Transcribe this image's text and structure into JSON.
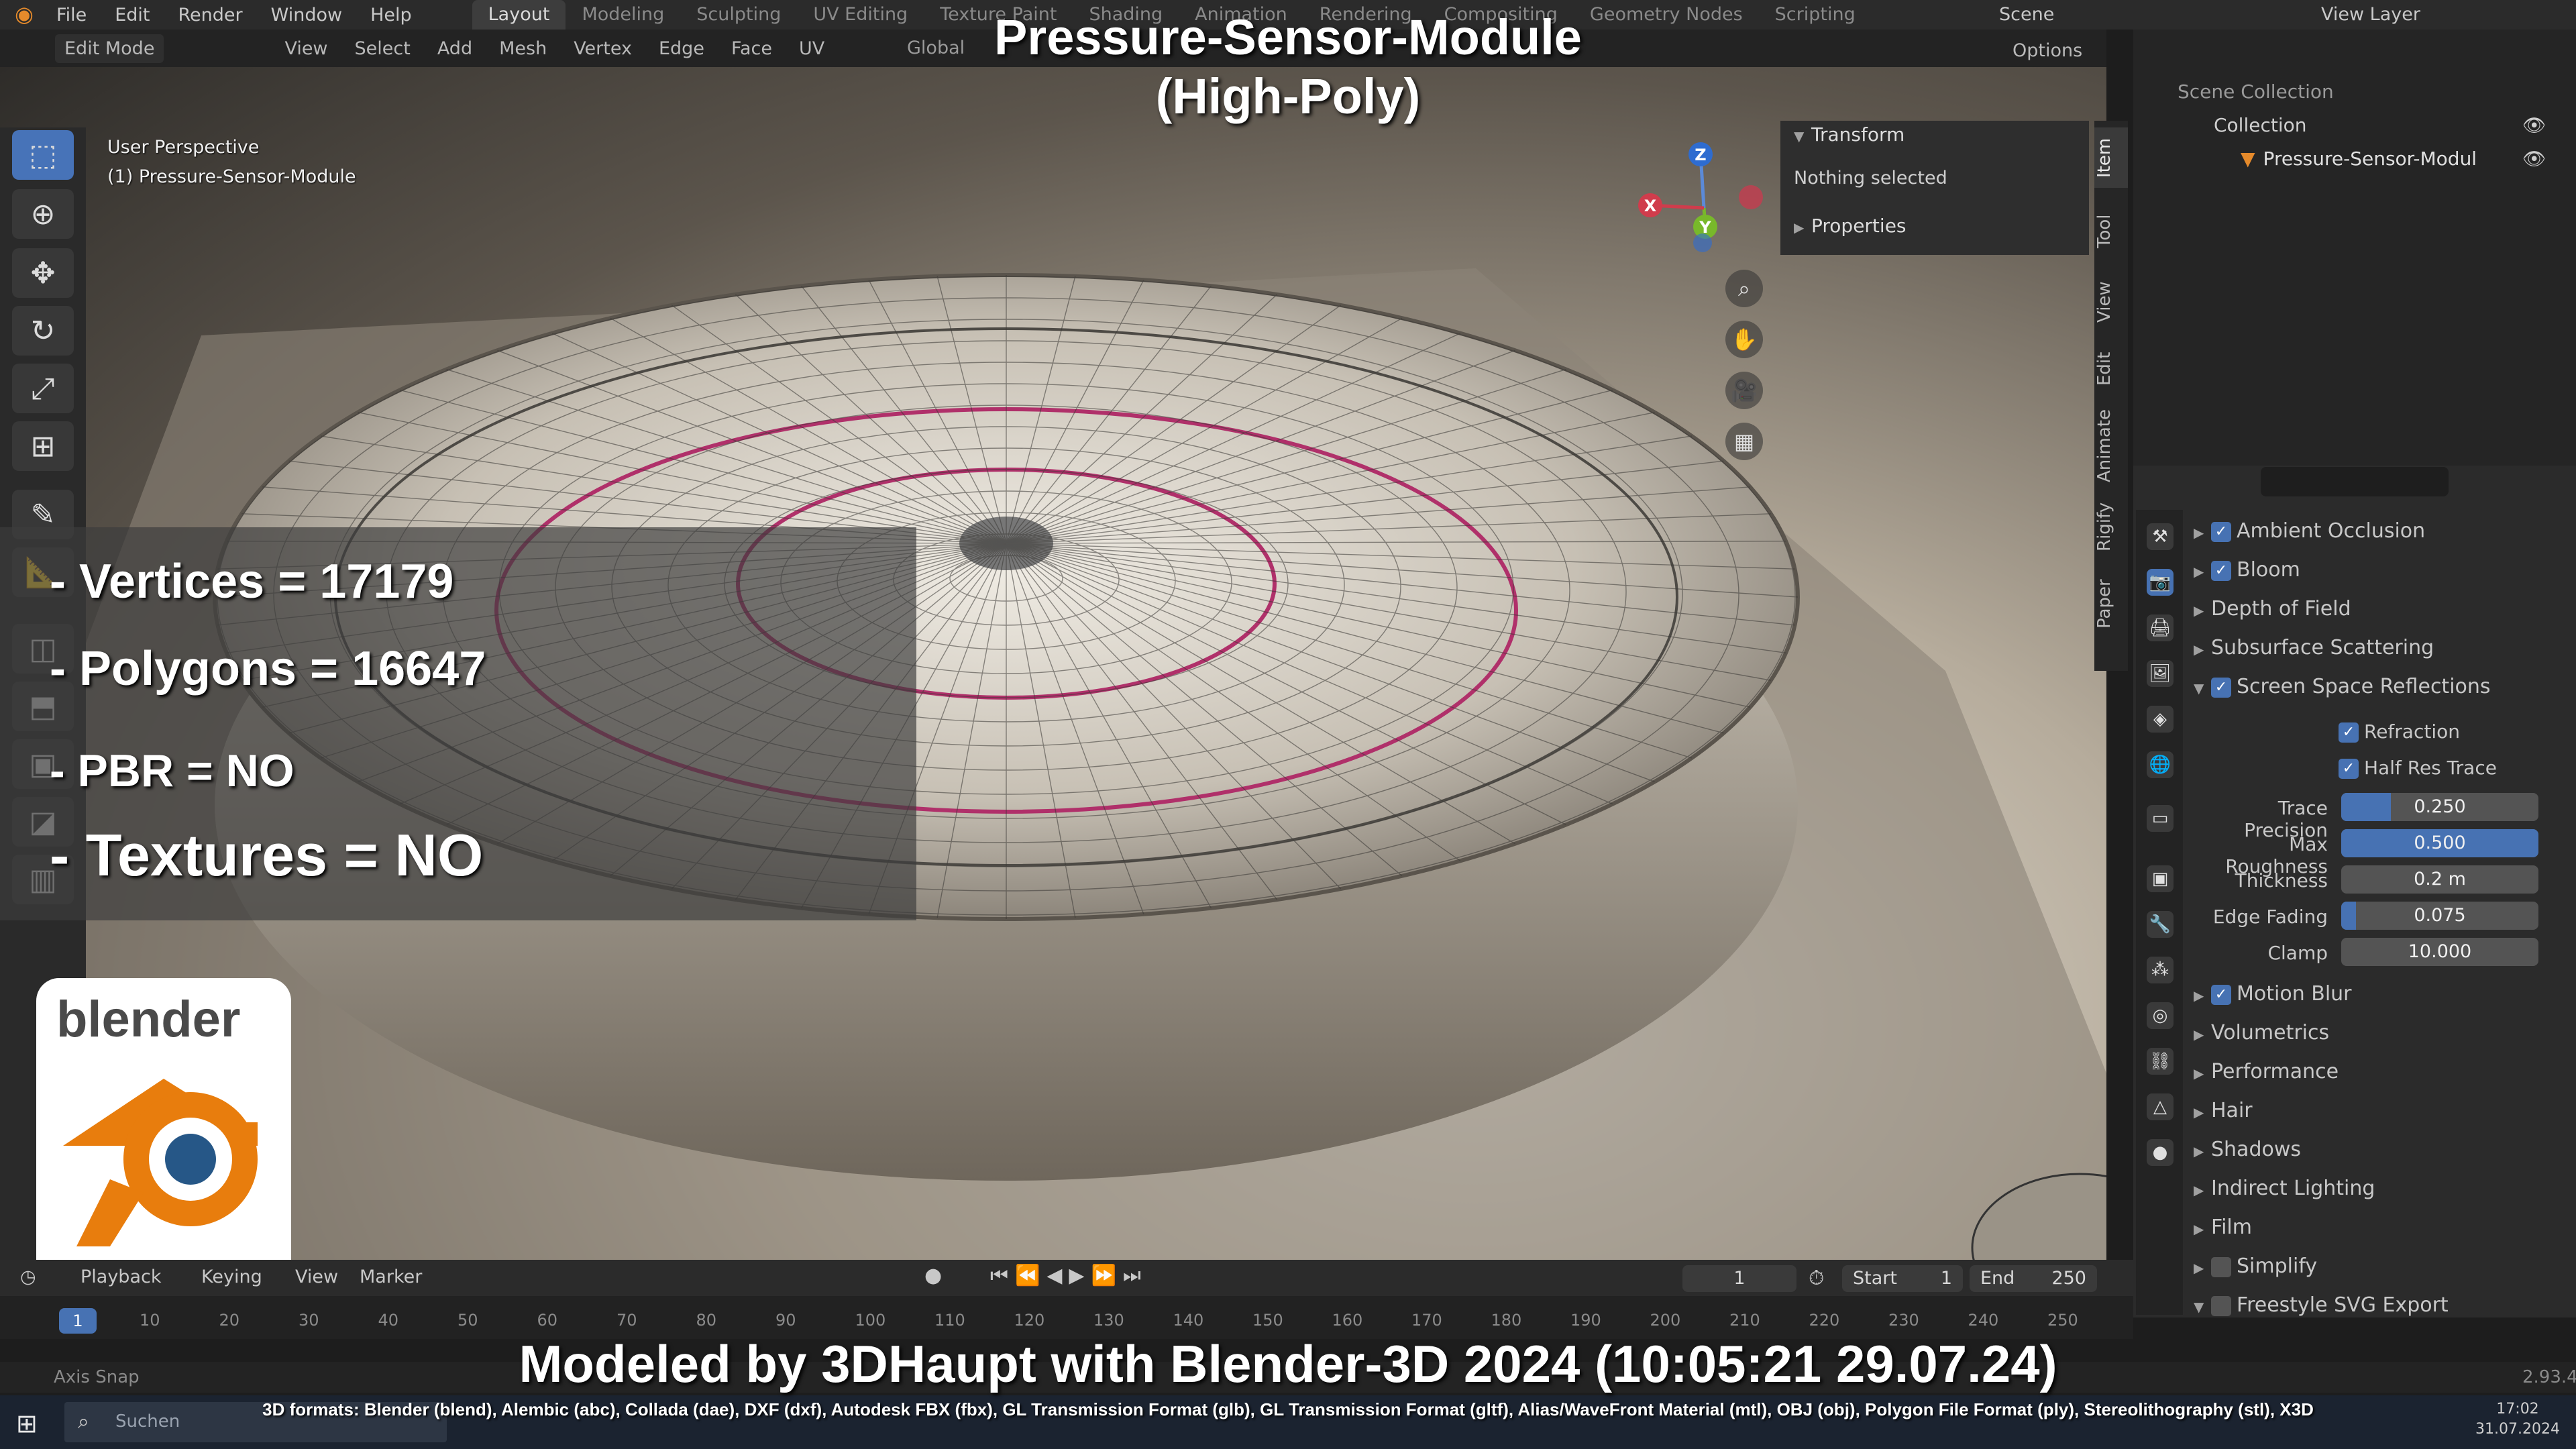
{
  "menu": [
    "File",
    "Edit",
    "Render",
    "Window",
    "Help"
  ],
  "workspace_tabs": [
    "Layout",
    "Modeling",
    "Sculpting",
    "UV Editing",
    "Texture Paint",
    "Shading",
    "Animation",
    "Rendering",
    "Compositing",
    "Geometry Nodes",
    "Scripting"
  ],
  "active_tab": "Layout",
  "scene_label": "Scene",
  "view_layer_label": "View Layer",
  "viewport_header": {
    "mode": "Edit Mode",
    "items": [
      "View",
      "Select",
      "Add",
      "Mesh",
      "Vertex",
      "Edge",
      "Face",
      "UV"
    ],
    "orientation": "Global",
    "options": "Options"
  },
  "viewport_info": {
    "perspective": "User Perspective",
    "object": "(1) Pressure-Sensor-Module"
  },
  "overlay": {
    "title_line1": "Pressure-Sensor-Module",
    "title_line2": "(High-Poly)",
    "stat_vertices": "- Vertices = 17179",
    "stat_polygons": "- Polygons = 16647",
    "stat_pbr": "- PBR =  NO",
    "stat_textures": "- Textures = NO",
    "logo_text": "blender",
    "credit": "Modeled by 3DHaupt with Blender-3D 2024 (10:05:21  29.07.24)",
    "formats": "3D formats: Blender (blend), Alembic (abc), Collada (dae), DXF (dxf), Autodesk FBX (fbx), GL Transmission Format (glb), GL Transmission Format (gltf), Alias/WaveFront Material (mtl), OBJ (obj), Polygon File Format (ply), Stereolithography (stl), X3D"
  },
  "gizmo": {
    "z": "Z",
    "y": "Y",
    "x": "X"
  },
  "sidebar": {
    "transform": "Transform",
    "nothing_selected": "Nothing selected",
    "properties": "Properties",
    "tabs": [
      "Item",
      "Tool",
      "View",
      "Edit",
      "Animate",
      "Rigify",
      "Paper"
    ]
  },
  "outliner": {
    "root": "Scene Collection",
    "collection": "Collection",
    "object": "Pressure-Sensor-Modul"
  },
  "properties": {
    "panels": [
      {
        "label": "Ambient Occlusion",
        "checkbox": true,
        "checked": true,
        "expanded": false
      },
      {
        "label": "Bloom",
        "checkbox": true,
        "checked": true,
        "expanded": false
      },
      {
        "label": "Depth of Field",
        "checkbox": false,
        "checked": false,
        "expanded": false
      },
      {
        "label": "Subsurface Scattering",
        "checkbox": false,
        "checked": false,
        "expanded": false
      },
      {
        "label": "Screen Space Reflections",
        "checkbox": true,
        "checked": true,
        "expanded": true
      }
    ],
    "ssr_options": [
      {
        "label": "Refraction",
        "checked": true
      },
      {
        "label": "Half Res Trace",
        "checked": true
      }
    ],
    "ssr_fields": [
      {
        "label": "Trace Precision",
        "value": "0.250",
        "fill": 0.25
      },
      {
        "label": "Max Roughness",
        "value": "0.500",
        "fill": 1.0
      },
      {
        "label": "Thickness",
        "value": "0.2 m",
        "fill": 0.0
      },
      {
        "label": "Edge Fading",
        "value": "0.075",
        "fill": 0.075
      },
      {
        "label": "Clamp",
        "value": "10.000",
        "fill": 0.0
      }
    ],
    "panels_after": [
      {
        "label": "Motion Blur",
        "checkbox": true,
        "checked": true,
        "expanded": false
      },
      {
        "label": "Volumetrics",
        "checkbox": false,
        "checked": false,
        "expanded": false
      },
      {
        "label": "Performance",
        "checkbox": false,
        "checked": false,
        "expanded": false
      },
      {
        "label": "Hair",
        "checkbox": false,
        "checked": false,
        "expanded": false
      },
      {
        "label": "Shadows",
        "checkbox": false,
        "checked": false,
        "expanded": false
      },
      {
        "label": "Indirect Lighting",
        "checkbox": false,
        "checked": false,
        "expanded": false
      },
      {
        "label": "Film",
        "checkbox": false,
        "checked": false,
        "expanded": false
      },
      {
        "label": "Simplify",
        "checkbox": true,
        "checked": false,
        "expanded": false
      },
      {
        "label": "Freestyle SVG Export",
        "checkbox": true,
        "checked": false,
        "expanded": true
      }
    ]
  },
  "timeline": {
    "playback": "Playback",
    "keying": "Keying",
    "view": "View",
    "marker": "Marker",
    "current_frame": "1",
    "start_label": "Start",
    "start": "1",
    "end_label": "End",
    "end": "250",
    "ruler_current": "1",
    "ticks": [
      "10",
      "20",
      "30",
      "40",
      "50",
      "60",
      "70",
      "80",
      "90",
      "100",
      "110",
      "120",
      "130",
      "140",
      "150",
      "160",
      "170",
      "180",
      "190",
      "200",
      "210",
      "220",
      "230",
      "240",
      "250"
    ]
  },
  "statusbar": {
    "left": "Axis Snap",
    "version": "2.93.4"
  },
  "taskbar": {
    "search": "Suchen",
    "time": "17:02",
    "date": "31.07.2024"
  }
}
